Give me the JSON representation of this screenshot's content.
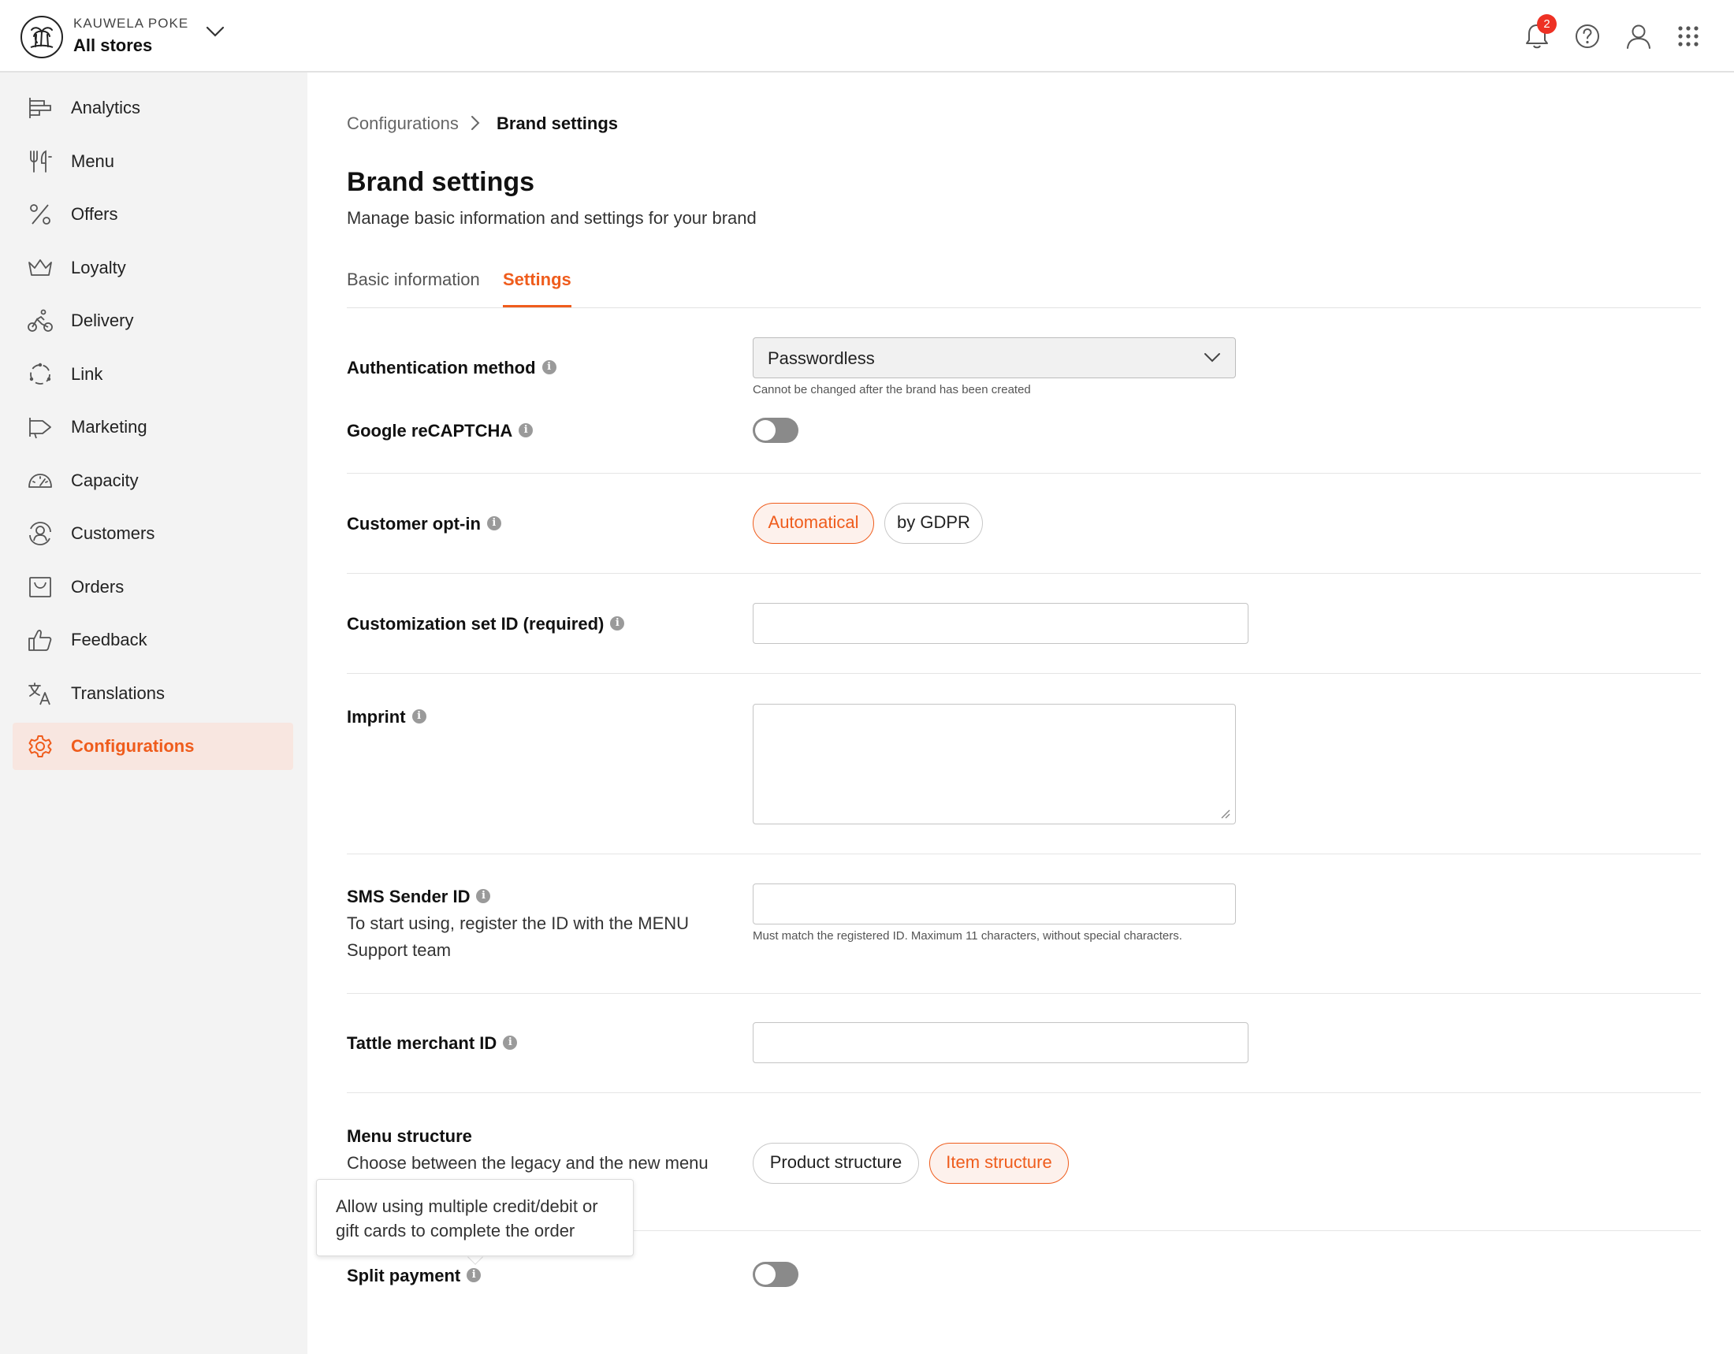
{
  "header": {
    "brand_name": "KAUWELA POKE",
    "store": "All stores",
    "notification_count": "2"
  },
  "sidebar": {
    "items": [
      {
        "label": "Analytics",
        "icon": "analytics-icon"
      },
      {
        "label": "Menu",
        "icon": "fork-knife-icon"
      },
      {
        "label": "Offers",
        "icon": "percent-icon"
      },
      {
        "label": "Loyalty",
        "icon": "crown-icon"
      },
      {
        "label": "Delivery",
        "icon": "bike-icon"
      },
      {
        "label": "Link",
        "icon": "link-circle-icon"
      },
      {
        "label": "Marketing",
        "icon": "megaphone-icon"
      },
      {
        "label": "Capacity",
        "icon": "gauge-icon"
      },
      {
        "label": "Customers",
        "icon": "customers-icon"
      },
      {
        "label": "Orders",
        "icon": "inbox-icon"
      },
      {
        "label": "Feedback",
        "icon": "thumbs-up-icon"
      },
      {
        "label": "Translations",
        "icon": "translate-icon"
      },
      {
        "label": "Configurations",
        "icon": "gear-icon"
      }
    ],
    "active": "Configurations"
  },
  "breadcrumb": {
    "parent": "Configurations",
    "current": "Brand settings"
  },
  "page": {
    "title": "Brand settings",
    "subtitle": "Manage basic information and settings for your brand"
  },
  "tabs": {
    "basic": "Basic information",
    "settings": "Settings",
    "active": "Settings"
  },
  "settings": {
    "auth_method": {
      "label": "Authentication method",
      "value": "Passwordless",
      "hint": "Cannot be changed after the brand has been created"
    },
    "recaptcha": {
      "label": "Google reCAPTCHA",
      "enabled": false
    },
    "opt_in": {
      "label": "Customer opt-in",
      "options": [
        "Automatical",
        "by GDPR"
      ],
      "selected": "Automatical"
    },
    "customization_set": {
      "label": "Customization set ID (required)",
      "value": ""
    },
    "imprint": {
      "label": "Imprint",
      "value": ""
    },
    "sms_sender": {
      "label": "SMS Sender ID",
      "description": "To start using, register the ID with the MENU Support team",
      "value": "",
      "hint": "Must match the registered ID. Maximum 11 characters, without special characters."
    },
    "tattle": {
      "label": "Tattle merchant ID",
      "value": ""
    },
    "menu_structure": {
      "label": "Menu structure",
      "description": "Choose between the legacy and the new menu",
      "options": [
        "Product structure",
        "Item structure"
      ],
      "selected": "Item structure"
    },
    "split_payment": {
      "label": "Split payment",
      "enabled": false,
      "tooltip": "Allow using multiple credit/debit or gift cards to complete the order"
    }
  },
  "colors": {
    "accent": "#ef5c1c",
    "sidebar_bg": "#f3f3f3",
    "active_item_bg": "#f8e6e0",
    "badge": "#ee3124"
  }
}
